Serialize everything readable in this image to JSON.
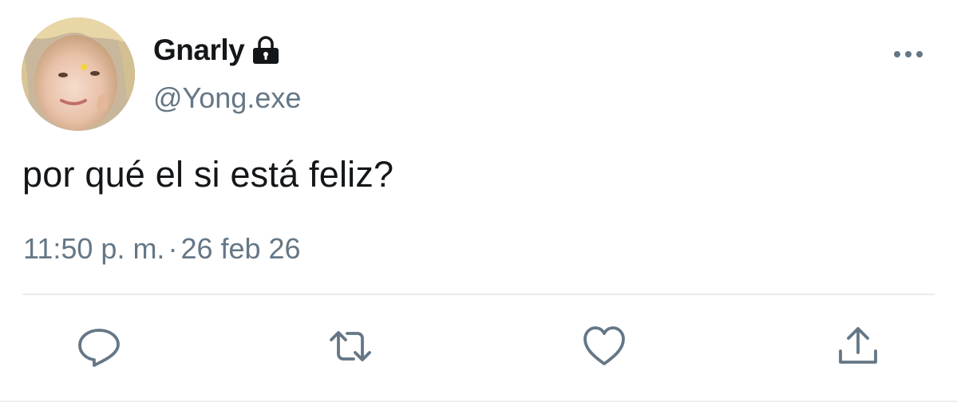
{
  "tweet": {
    "display_name": "Gnarly",
    "handle": "@Yong.exe",
    "text": "por qué el si está feliz?",
    "time": "11:50 p. m.",
    "separator": "·",
    "date": "26 feb 26",
    "protected": true
  },
  "icons": {
    "lock": "lock-icon",
    "more": "more-options-icon",
    "reply": "reply-icon",
    "retweet": "retweet-icon",
    "like": "heart-icon",
    "share": "share-icon"
  },
  "colors": {
    "text_primary": "#14171a",
    "text_secondary": "#657786",
    "icon_gray": "#657786",
    "divider": "#e6ecf0",
    "background": "#ffffff"
  }
}
